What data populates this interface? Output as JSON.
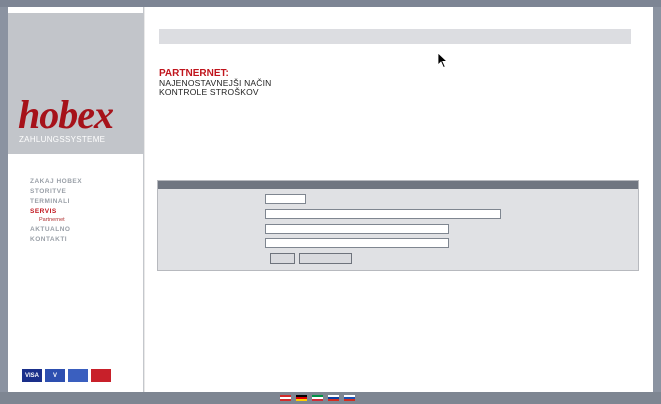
{
  "brand": {
    "logo": "hobex",
    "subtitle": "ZAHLUNGSSYSTEME"
  },
  "nav": {
    "items": [
      {
        "label": "ZAKAJ HOBEX"
      },
      {
        "label": "STORITVE"
      },
      {
        "label": "TERMINALI"
      },
      {
        "label": "SERVIS"
      }
    ],
    "sub_items": [
      {
        "label": "Partnernet"
      },
      {
        "label": ""
      },
      {
        "label": ""
      }
    ],
    "items_after": [
      {
        "label": "AKTUALNO"
      },
      {
        "label": "KONTAKTI"
      }
    ]
  },
  "cards": [
    {
      "label": "VISA",
      "color": "#1a2f8a"
    },
    {
      "label": "V",
      "color": "#2d4fb0"
    },
    {
      "label": "",
      "color": "#3a5fbf"
    },
    {
      "label": "",
      "color": "#c8202a"
    }
  ],
  "menu": [
    {
      "label": ""
    },
    {
      "label": ""
    },
    {
      "label": ""
    },
    {
      "label": ""
    },
    {
      "label": ""
    },
    {
      "label": ""
    }
  ],
  "headline": {
    "red": "PARTNERNET:",
    "line1": "NAJENOSTAVNEJŠI NAČIN",
    "line2": "KONTROLE STROŠKOV"
  },
  "note": "",
  "form": {
    "title": "",
    "fields": [
      {
        "label": "",
        "value": ""
      },
      {
        "label": "",
        "value": ""
      },
      {
        "label": "",
        "value": ""
      },
      {
        "label": "",
        "value": ""
      }
    ],
    "primary_button": "",
    "secondary_button": ""
  },
  "version": "",
  "footer": {
    "links": ""
  },
  "flags": [
    {
      "stripes": [
        "#d22b2b",
        "#ffffff",
        "#d22b2b"
      ]
    },
    {
      "stripes": [
        "#000000",
        "#dd0000",
        "#ffce00"
      ]
    },
    {
      "stripes": [
        "#009246",
        "#ffffff",
        "#ce2b37"
      ]
    },
    {
      "stripes": [
        "#ffffff",
        "#0d3fa0",
        "#d52b1e"
      ]
    },
    {
      "stripes": [
        "#ffffff",
        "#1a4fb0",
        "#d52b1e"
      ]
    }
  ]
}
